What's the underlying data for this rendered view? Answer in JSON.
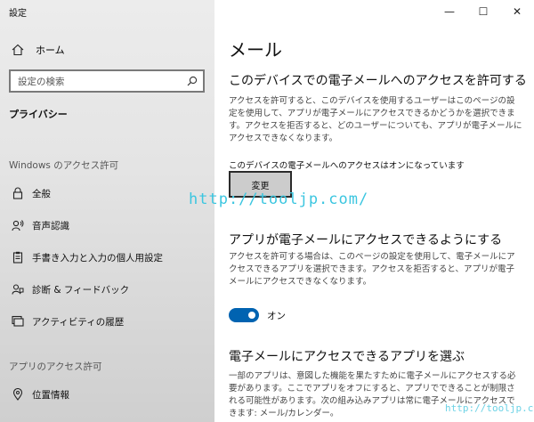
{
  "app_title": "設定",
  "window_controls": {
    "minimize": "—",
    "maximize": "☐",
    "close": "✕"
  },
  "sidebar": {
    "home_label": "ホーム",
    "search_placeholder": "設定の検索",
    "current_category": "プライバシー",
    "sections": [
      {
        "heading": "Windows のアクセス許可",
        "items": [
          {
            "label": "全般",
            "icon": "lock-icon"
          },
          {
            "label": "音声認識",
            "icon": "speech-icon"
          },
          {
            "label": "手書き入力と入力の個人用設定",
            "icon": "clipboard-icon"
          },
          {
            "label": "診断 & フィードバック",
            "icon": "feedback-icon"
          },
          {
            "label": "アクティビティの履歴",
            "icon": "history-icon"
          }
        ]
      },
      {
        "heading": "アプリのアクセス許可",
        "items": [
          {
            "label": "位置情報",
            "icon": "location-icon"
          }
        ]
      }
    ]
  },
  "main": {
    "page_title": "メール",
    "section1": {
      "title": "このデバイスでの電子メールへのアクセスを許可する",
      "description": "アクセスを許可すると、このデバイスを使用するユーザーはこのページの設定を使用して、アプリが電子メールにアクセスできるかどうかを選択できます。アクセスを拒否すると、どのユーザーについても、アプリが電子メールにアクセスできなくなります。",
      "status": "このデバイスの電子メールへのアクセスはオンになっています",
      "change_button": "変更"
    },
    "section2": {
      "title": "アプリが電子メールにアクセスできるようにする",
      "description": "アクセスを許可する場合は、このページの設定を使用して、電子メールにアクセスできるアプリを選択できます。アクセスを拒否すると、アプリが電子メールにアクセスできなくなります。",
      "toggle_state": "オン",
      "toggle_on": true
    },
    "section3": {
      "title": "電子メールにアクセスできるアプリを選ぶ",
      "description": "一部のアプリは、意図した機能を果たすために電子メールにアクセスする必要があります。ここでアプリをオフにすると、アプリでできることが制限される可能性があります。次の組み込みアプリは常に電子メールにアクセスできます: メール/カレンダー。"
    }
  },
  "watermark": {
    "main": "http://tooljp.com/",
    "corner": "http://tooljp.com/"
  },
  "colors": {
    "accent": "#0063b1",
    "sidebar_bg": "#e6e6e6",
    "watermark": "#3cc6e0"
  }
}
